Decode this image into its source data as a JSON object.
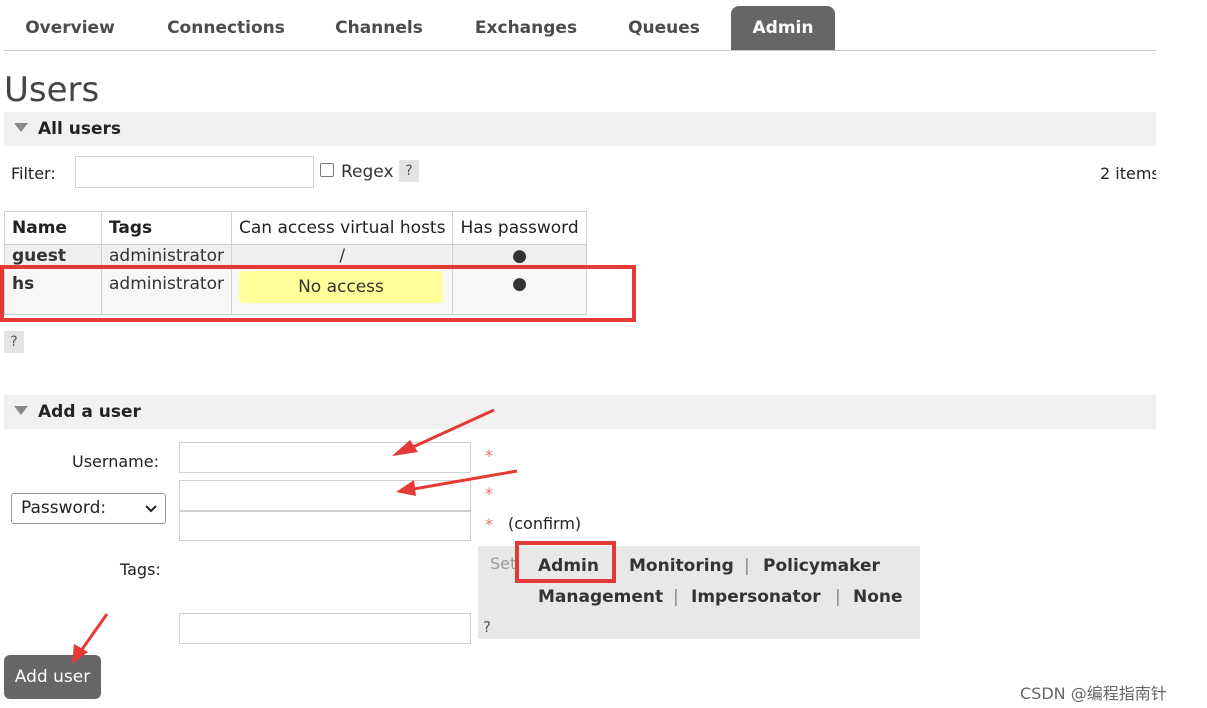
{
  "nav": {
    "tabs": [
      {
        "label": "Overview"
      },
      {
        "label": "Connections"
      },
      {
        "label": "Channels"
      },
      {
        "label": "Exchanges"
      },
      {
        "label": "Queues"
      },
      {
        "label": "Admin"
      }
    ]
  },
  "page": {
    "title": "Users"
  },
  "all_users": {
    "heading": "All users",
    "filter_label": "Filter:",
    "regex_label": "Regex",
    "help": "?",
    "items_count": "2 items",
    "table": {
      "headers": [
        "Name",
        "Tags",
        "Can access virtual hosts",
        "Has password"
      ],
      "rows": [
        {
          "name": "guest",
          "tags": "administrator",
          "vhosts": "/",
          "has_password": "●"
        },
        {
          "name": "hs",
          "tags": "administrator",
          "vhosts": "No access",
          "has_password": "●"
        }
      ]
    },
    "table_help": "?"
  },
  "add_user": {
    "heading": "Add a user",
    "username_label": "Username:",
    "password_select": "Password:",
    "required_mark": "*",
    "confirm_label": "(confirm)",
    "tags_label": "Tags:",
    "tags_set_prefix": "Set",
    "tags": [
      "Admin",
      "Monitoring",
      "Policymaker",
      "Management",
      "Impersonator",
      "None"
    ],
    "separator": "|",
    "tags_help": "?",
    "button": "Add user"
  },
  "watermark": "CSDN @编程指南针",
  "colors": {
    "accent_tab": "#666666",
    "highlight": "#ffff99",
    "annotation_red": "#e53935"
  }
}
